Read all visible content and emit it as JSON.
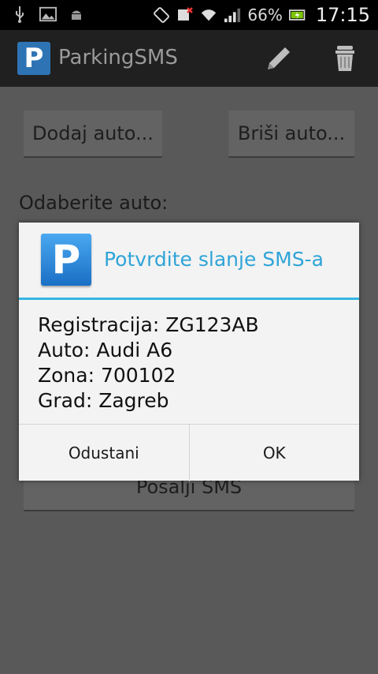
{
  "status_bar": {
    "battery_percent": "66%",
    "time": "17:15",
    "icons": [
      "usb-icon",
      "image-icon",
      "android-icon",
      "rotate-icon",
      "sms-blocked-icon",
      "wifi-icon",
      "signal-icon",
      "battery-charging-icon"
    ]
  },
  "action_bar": {
    "app_icon_letter": "P",
    "title": "ParkingSMS",
    "actions": [
      "edit-icon",
      "trash-icon"
    ]
  },
  "content": {
    "add_car_button": "Dodaj auto...",
    "delete_car_button": "Briši auto...",
    "choose_car_label": "Odaberite auto:",
    "send_sms_button": "Posalji SMS"
  },
  "dialog": {
    "icon_letter": "P",
    "title": "Potvrdite slanje SMS-a",
    "lines": [
      "Registracija: ZG123AB",
      "Auto: Audi A6",
      "Zona: 700102",
      "Grad: Zagreb"
    ],
    "cancel_button": "Odustani",
    "ok_button": "OK"
  },
  "colors": {
    "accent": "#33b5e5",
    "dialog_title": "#2fa4d8",
    "app_icon": "#2e74b5"
  }
}
